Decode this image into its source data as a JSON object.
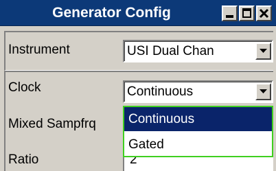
{
  "window": {
    "title": "Generator Config",
    "controls": [
      "minimize-icon",
      "maximize-icon",
      "close-icon"
    ]
  },
  "fields": {
    "instrument": {
      "label": "Instrument",
      "value": "USI Dual Chan"
    },
    "clock": {
      "label": "Clock",
      "value": "Continuous"
    },
    "mixed_sampfrq": {
      "label": "Mixed Sampfrq"
    },
    "ratio": {
      "label": "Ratio",
      "value": "2"
    }
  },
  "clock_dropdown": {
    "options": [
      "Continuous",
      "Gated"
    ],
    "selected": "Continuous"
  },
  "colors": {
    "titlebar": "#0c3978",
    "window_bg": "#d4d0c8",
    "selection": "#0a246a",
    "focus_border": "#3fcf1f"
  }
}
